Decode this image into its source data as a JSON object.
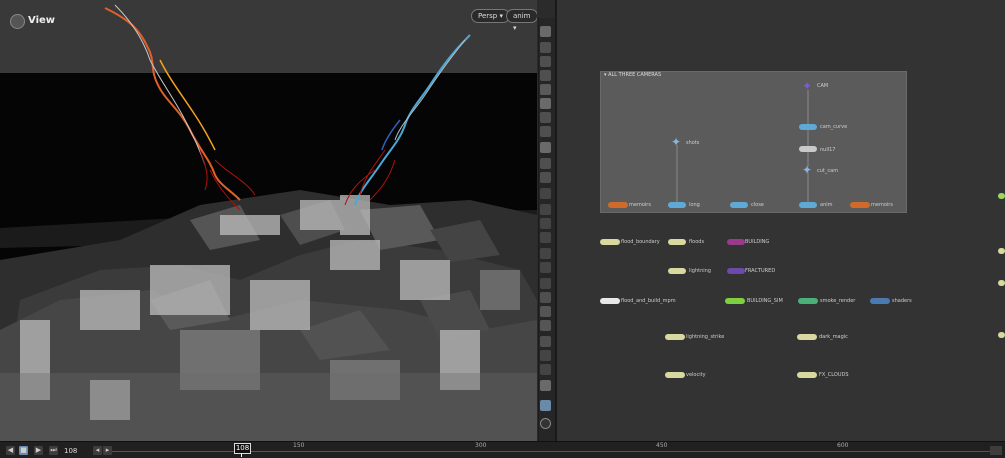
{
  "viewport": {
    "title": "View",
    "camera_menu": "Persp ▾",
    "cam_menu": "anim ▾"
  },
  "network": {
    "box_title": "▾ ALL THREE CAMERAS",
    "nodes": {
      "cam_null": "CAM",
      "shots": "shots",
      "cam_curve": "cam_curve",
      "cam_null2": "null17",
      "cut_cam": "cut_cam",
      "memory_left": "memoirs",
      "long": "long",
      "close": "close",
      "anim": "anim",
      "memory_right": "memoirs",
      "flood_boundary": "flood_boundary",
      "floods": "floods",
      "building": "BUILDING",
      "lightning": "lightning",
      "fractured": "FRACTURED",
      "flood_and_build_mpm": "flood_and_build_mpm",
      "building_sim": "BUILDING_SIM",
      "smoke_render": "smoke_render",
      "shaders": "shaders",
      "lightning_strike": "lightning_strike",
      "dark_magic": "dark_magic",
      "velocity": "velocity",
      "fx_cloud": "FX_CLOUDS"
    }
  },
  "timeline": {
    "frame": "108",
    "current_frame": "108",
    "ticks": [
      "150",
      "300",
      "450",
      "600"
    ]
  },
  "colors": {
    "accent_blue": "#6ab0e0",
    "viewport_black": "#050505",
    "network_bg": "#333333"
  }
}
